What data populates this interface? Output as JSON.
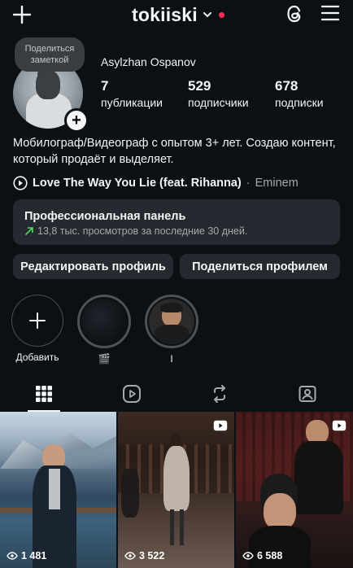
{
  "header": {
    "handle": "tokiiski",
    "icons": {
      "new_post": "plus-icon",
      "switch_account": "chevron-down-icon",
      "threads": "threads-icon",
      "menu": "hamburger-menu-icon"
    },
    "notification_dot_color": "#ff2d55"
  },
  "profile": {
    "note_line1": "Поделиться",
    "note_line2": "заметкой",
    "full_name": "Asylzhan Ospanov",
    "stats": [
      {
        "value": "7",
        "label": "публикации"
      },
      {
        "value": "529",
        "label": "подписчики"
      },
      {
        "value": "678",
        "label": "подписки"
      }
    ],
    "bio": "Мобилограф/Видеограф с опытом 3+ лет. Создаю контент, который продаёт и выделяет.",
    "song_title": "Love The Way You Lie (feat. Rihanna)",
    "song_sep": "·",
    "song_artist": "Eminem"
  },
  "pro_panel": {
    "title": "Профессиональная панель",
    "subtitle": "13,8 тыс. просмотров за последние 30 дней.",
    "trend_color": "#4cd964"
  },
  "actions": {
    "edit_profile": "Редактировать профиль",
    "share_profile": "Поделиться профилем"
  },
  "highlights": [
    {
      "label": "Добавить",
      "icon": "plus-icon"
    },
    {
      "label": "🎬"
    },
    {
      "label": "I"
    }
  ],
  "tabs": [
    "grid-icon",
    "reels-icon",
    "reposts-icon",
    "tagged-icon"
  ],
  "posts": [
    {
      "views": "1 481",
      "is_reel": false
    },
    {
      "views": "3 522",
      "is_reel": true
    },
    {
      "views": "6 588",
      "is_reel": true
    }
  ]
}
